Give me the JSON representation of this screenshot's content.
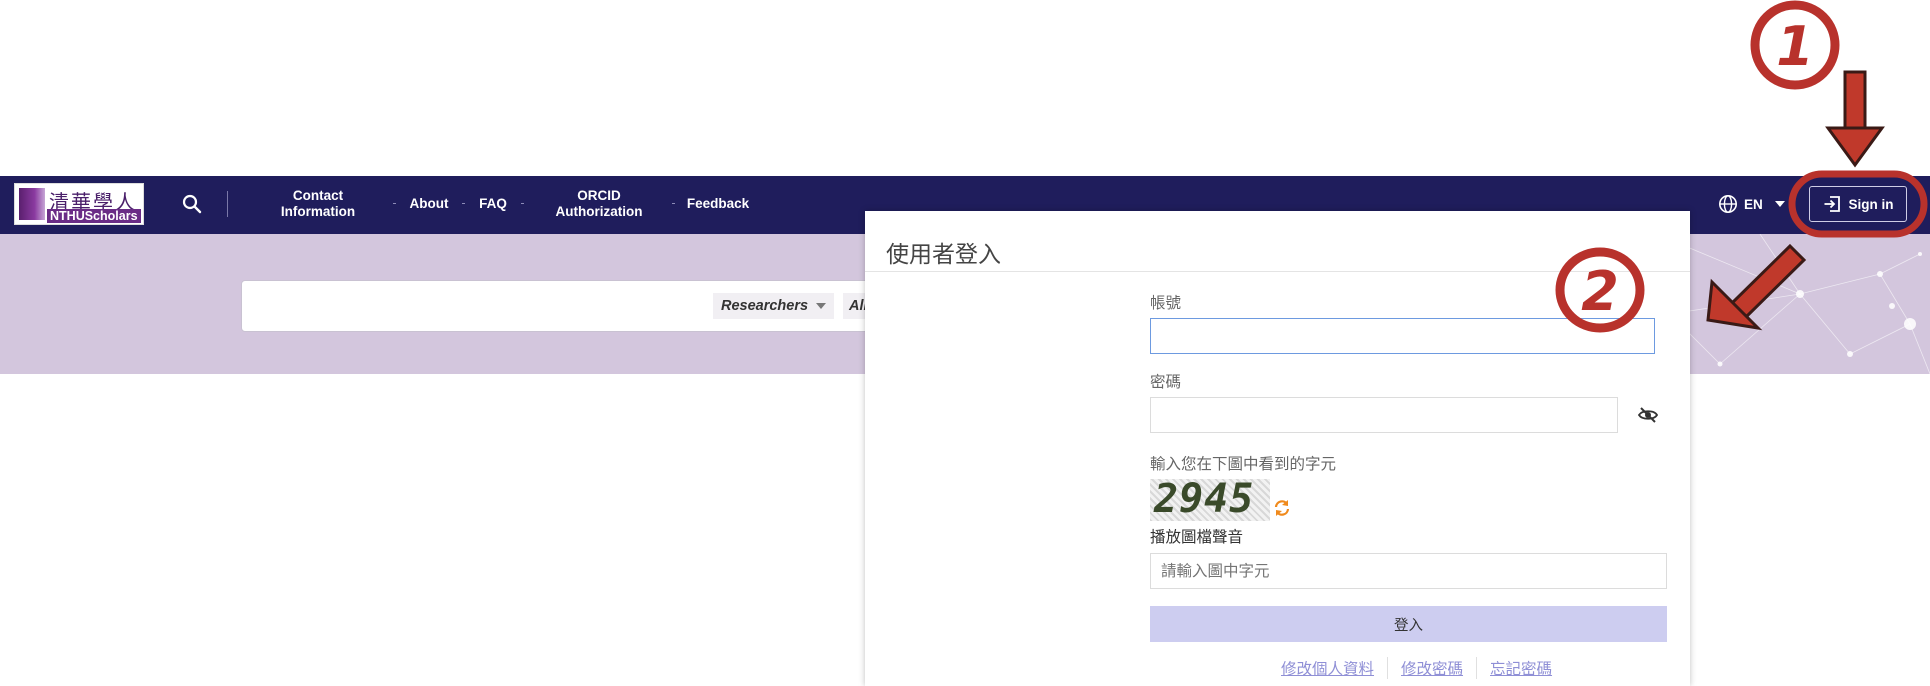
{
  "navbar": {
    "logo": {
      "cn_text": "清華學人",
      "en_text": "NTHUScholars"
    },
    "links": [
      {
        "label": "Contact\nInformation"
      },
      {
        "label": "About"
      },
      {
        "label": "FAQ"
      },
      {
        "label": "ORCID\nAuthorization"
      },
      {
        "label": "Feedback"
      }
    ],
    "language": "EN",
    "sign_in_label": "Sign in"
  },
  "hero": {
    "search_scope": "Researchers",
    "search_scope_2": "All"
  },
  "login_modal": {
    "title": "使用者登入",
    "account_label": "帳號",
    "account_value": "",
    "password_label": "密碼",
    "password_value": "",
    "captcha_prompt": "輸入您在下圖中看到的字元",
    "captcha_image_text": "2945",
    "audio_link": "播放圖檔聲音",
    "captcha_placeholder": "請輸入圖中字元",
    "submit_label": "登入",
    "footer_links": [
      "修改個人資料",
      "修改密碼",
      "忘記密碼"
    ]
  },
  "annotations": {
    "step1": "1",
    "step2": "2",
    "color": "#b8322c"
  },
  "colors": {
    "navbar_bg": "#1f1d5c",
    "hero_bg": "#d3c6dd",
    "login_button_bg": "#cdcdf0",
    "link_color": "#8f8fd6"
  }
}
